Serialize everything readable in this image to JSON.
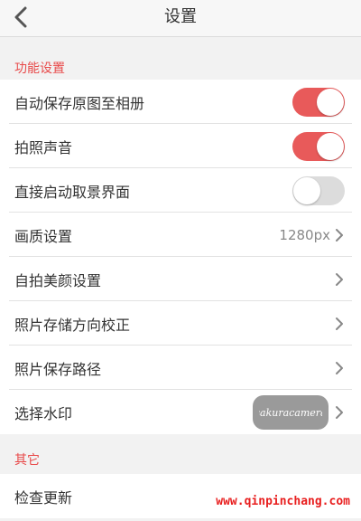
{
  "header": {
    "title": "设置"
  },
  "sections": [
    {
      "title": "功能设置",
      "items": [
        {
          "label": "自动保存原图至相册",
          "control": "toggle",
          "state": "on"
        },
        {
          "label": "拍照声音",
          "control": "toggle",
          "state": "on"
        },
        {
          "label": "直接启动取景界面",
          "control": "toggle",
          "state": "off"
        },
        {
          "label": "画质设置",
          "control": "value",
          "value": "1280px"
        },
        {
          "label": "自拍美颜设置",
          "control": "chevron"
        },
        {
          "label": "照片存储方向校正",
          "control": "chevron"
        },
        {
          "label": "照片保存路径",
          "control": "chevron"
        },
        {
          "label": "选择水印",
          "control": "watermark",
          "watermark_text": "sakuracamera"
        }
      ]
    },
    {
      "title": "其它",
      "items": [
        {
          "label": "检查更新",
          "control": "none"
        }
      ]
    }
  ],
  "overlay": {
    "site_watermark": "www.qinpinchang.com"
  },
  "colors": {
    "accent": "#e84a4a",
    "toggle_on": "#e85a5a",
    "toggle_off": "#dcdcdc",
    "background": "#f2f2f2"
  },
  "icons": {
    "back": "chevron-left-icon",
    "row_arrow": "chevron-right-icon"
  }
}
